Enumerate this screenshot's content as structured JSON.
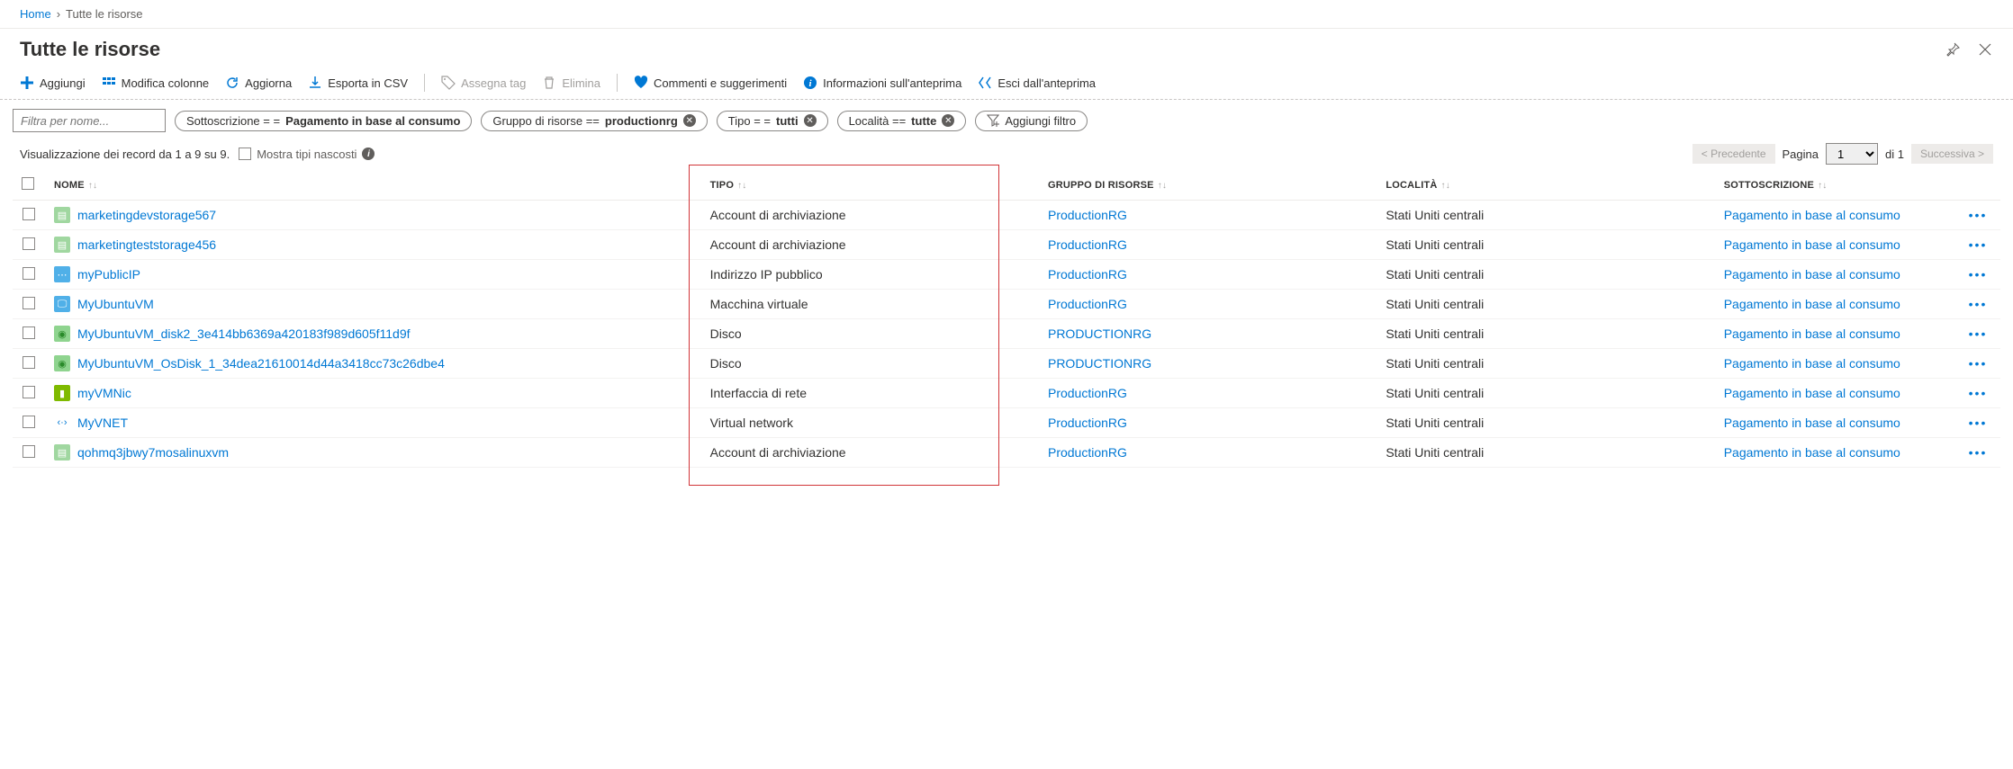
{
  "breadcrumb": {
    "home": "Home",
    "current": "Tutte le risorse"
  },
  "title": "Tutte le risorse",
  "toolbar": {
    "add": "Aggiungi",
    "edit_columns": "Modifica colonne",
    "refresh": "Aggiorna",
    "export_csv": "Esporta in CSV",
    "assign_tag": "Assegna tag",
    "delete": "Elimina",
    "feedback": "Commenti e suggerimenti",
    "preview_info": "Informazioni sull'anteprima",
    "exit_preview": "Esci dall'anteprima"
  },
  "filters": {
    "name_placeholder": "Filtra per nome...",
    "subscription_prefix": "Sottoscrizione = = ",
    "subscription_value": "Pagamento in base al consumo",
    "rg_prefix": "Gruppo di risorse == ",
    "rg_value": "productionrg",
    "type_prefix": "Tipo = = ",
    "type_value": "tutti",
    "location_prefix": "Località == ",
    "location_value": "tutte",
    "add_filter": "Aggiungi filtro"
  },
  "status": {
    "records_text": "Visualizzazione dei record da 1 a 9 su 9.",
    "show_hidden": "Mostra tipi nascosti"
  },
  "pager": {
    "prev": "< Precedente",
    "page_label": "Pagina",
    "page_value": "1",
    "of_total": "di 1",
    "next": "Successiva >"
  },
  "columns": {
    "name": "Nome",
    "type": "Tipo",
    "rg": "Gruppo di risorse",
    "location": "Località",
    "subscription": "Sottoscrizione"
  },
  "rows": [
    {
      "icon": "storage",
      "name": "marketingdevstorage567",
      "type": "Account di archiviazione",
      "rg": "ProductionRG",
      "loc": "Stati Uniti centrali",
      "sub": "Pagamento in base al consumo"
    },
    {
      "icon": "storage",
      "name": "marketingteststorage456",
      "type": "Account di archiviazione",
      "rg": "ProductionRG",
      "loc": "Stati Uniti centrali",
      "sub": "Pagamento in base al consumo"
    },
    {
      "icon": "ip",
      "name": "myPublicIP",
      "type": "Indirizzo IP pubblico",
      "rg": "ProductionRG",
      "loc": "Stati Uniti centrali",
      "sub": "Pagamento in base al consumo"
    },
    {
      "icon": "vm",
      "name": "MyUbuntuVM",
      "type": "Macchina virtuale",
      "rg": "ProductionRG",
      "loc": "Stati Uniti centrali",
      "sub": "Pagamento in base al consumo"
    },
    {
      "icon": "disk",
      "name": "MyUbuntuVM_disk2_3e414bb6369a420183f989d605f11d9f",
      "type": "Disco",
      "rg": "PRODUCTIONRG",
      "loc": "Stati Uniti centrali",
      "sub": "Pagamento in base al consumo"
    },
    {
      "icon": "disk",
      "name": "MyUbuntuVM_OsDisk_1_34dea21610014d44a3418cc73c26dbe4",
      "type": "Disco",
      "rg": "PRODUCTIONRG",
      "loc": "Stati Uniti centrali",
      "sub": "Pagamento in base al consumo"
    },
    {
      "icon": "nic",
      "name": "myVMNic",
      "type": "Interfaccia di rete",
      "rg": "ProductionRG",
      "loc": "Stati Uniti centrali",
      "sub": "Pagamento in base al consumo"
    },
    {
      "icon": "vnet",
      "name": "MyVNET",
      "type": "Virtual network",
      "rg": "ProductionRG",
      "loc": "Stati Uniti centrali",
      "sub": "Pagamento in base al consumo"
    },
    {
      "icon": "storage",
      "name": "qohmq3jbwy7mosalinuxvm",
      "type": "Account di archiviazione",
      "rg": "ProductionRG",
      "loc": "Stati Uniti centrali",
      "sub": "Pagamento in base al consumo"
    }
  ],
  "icons": {
    "storage": {
      "bg": "#a0d7a0",
      "fg": "#fff",
      "glyph": "▤"
    },
    "ip": {
      "bg": "#50b0e8",
      "fg": "#fff",
      "glyph": "⋯"
    },
    "vm": {
      "bg": "#50b0e8",
      "fg": "#fff",
      "glyph": "🖵"
    },
    "disk": {
      "bg": "#8fd48f",
      "fg": "#2a8a2a",
      "glyph": "◉"
    },
    "nic": {
      "bg": "#7fba00",
      "fg": "#fff",
      "glyph": "▮"
    },
    "vnet": {
      "bg": "#ffffff",
      "fg": "#0078d4",
      "glyph": "‹·›"
    }
  }
}
